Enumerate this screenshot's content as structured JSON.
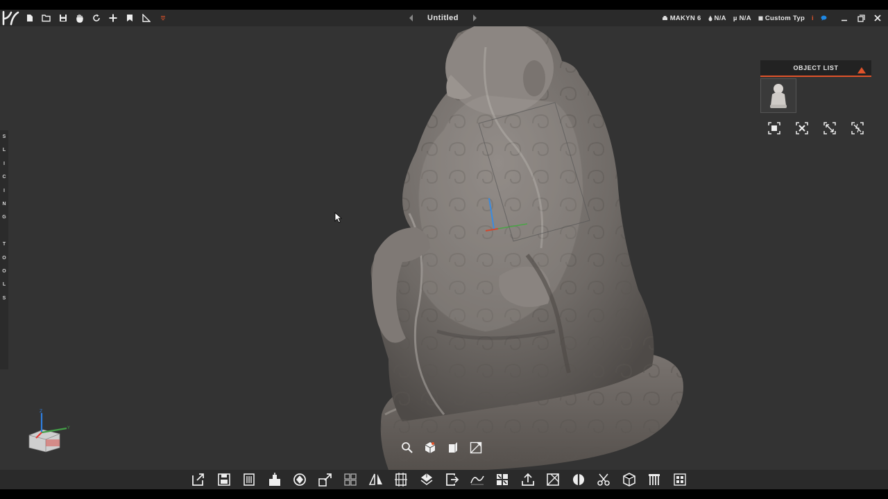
{
  "app": {
    "title": "Untitled",
    "logo_icon": "kiri-logo-icon"
  },
  "toolbar": {
    "items": [
      {
        "name": "new-file-icon"
      },
      {
        "name": "open-folder-icon"
      },
      {
        "name": "save-icon"
      },
      {
        "name": "hand-icon"
      },
      {
        "name": "rotate-icon"
      },
      {
        "name": "move-icon"
      },
      {
        "name": "bookmark-icon"
      },
      {
        "name": "measure-icon"
      },
      {
        "name": "menu-icon"
      }
    ]
  },
  "status": {
    "printer": "MAKYN 6",
    "metric1": "N/A",
    "metric2": "N/A",
    "material": "Custom Typ",
    "info_symbol": "i"
  },
  "side_tab": {
    "letters": [
      "S",
      "L",
      "I",
      "C",
      "I",
      "N",
      "G",
      "",
      "T",
      "O",
      "O",
      "L",
      "S"
    ]
  },
  "object_list": {
    "title": "OBJECT LIST",
    "tools": [
      {
        "name": "fit-selection-icon"
      },
      {
        "name": "delete-object-icon"
      },
      {
        "name": "scale-object-icon"
      },
      {
        "name": "auto-arrange-icon"
      }
    ]
  },
  "view_tools": [
    {
      "name": "zoom-icon"
    },
    {
      "name": "cube-view-icon"
    },
    {
      "name": "face-view-icon"
    },
    {
      "name": "perspective-icon"
    }
  ],
  "bottom_tools": [
    {
      "name": "export-icon"
    },
    {
      "name": "save-model-icon"
    },
    {
      "name": "delete-icon"
    },
    {
      "name": "place-icon"
    },
    {
      "name": "orient-icon"
    },
    {
      "name": "scale-icon"
    },
    {
      "name": "arrange-icon"
    },
    {
      "name": "mirror-icon"
    },
    {
      "name": "align-icon"
    },
    {
      "name": "layers-icon"
    },
    {
      "name": "exit-icon"
    },
    {
      "name": "curve-icon"
    },
    {
      "name": "split-icon"
    },
    {
      "name": "upload-icon"
    },
    {
      "name": "hollow-icon"
    },
    {
      "name": "slice-plane-icon"
    },
    {
      "name": "cut-icon"
    },
    {
      "name": "box-icon"
    },
    {
      "name": "supports-icon"
    },
    {
      "name": "pattern-icon"
    }
  ],
  "colors": {
    "accent": "#e0532a",
    "viewport_bg": "#333333",
    "toolbar_bg": "#2a2a2a"
  }
}
